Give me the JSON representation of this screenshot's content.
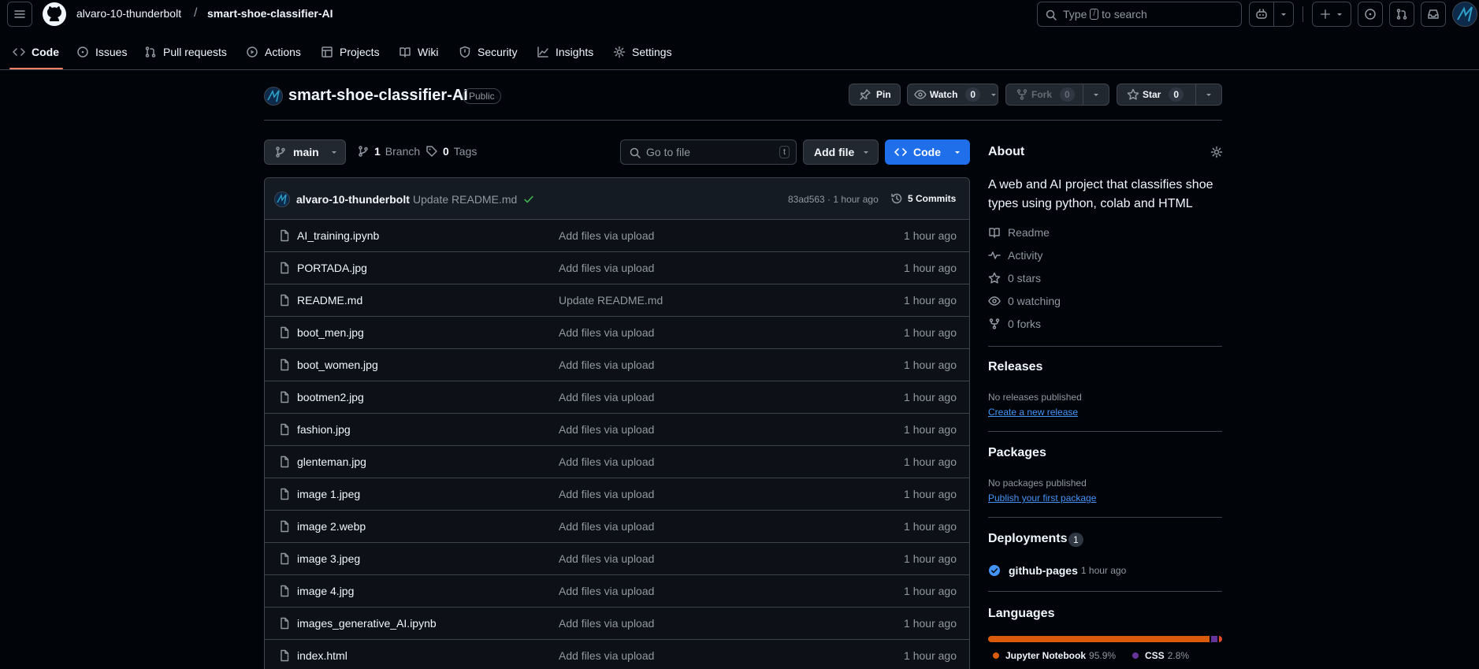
{
  "header": {
    "owner": "alvaro-10-thunderbolt",
    "separator": "/",
    "repo": "smart-shoe-classifier-AI",
    "search_before": "Type",
    "search_key": "/",
    "search_after": "to search"
  },
  "nav": {
    "tabs": [
      {
        "label": "Code",
        "icon": "code-icon"
      },
      {
        "label": "Issues",
        "icon": "issue-icon"
      },
      {
        "label": "Pull requests",
        "icon": "pull-request-icon"
      },
      {
        "label": "Actions",
        "icon": "play-icon"
      },
      {
        "label": "Projects",
        "icon": "table-icon"
      },
      {
        "label": "Wiki",
        "icon": "book-icon"
      },
      {
        "label": "Security",
        "icon": "shield-icon"
      },
      {
        "label": "Insights",
        "icon": "graph-icon"
      },
      {
        "label": "Settings",
        "icon": "gear-icon"
      }
    ]
  },
  "repo": {
    "name": "smart-shoe-classifier-AI",
    "visibility": "Public",
    "pin_label": "Pin",
    "watch_label": "Watch",
    "watch_count": "0",
    "fork_label": "Fork",
    "fork_count": "0",
    "star_label": "Star",
    "star_count": "0"
  },
  "toolbar": {
    "branch": "main",
    "branch_count": "1",
    "branch_label": "Branch",
    "tag_count": "0",
    "tag_label": "Tags",
    "goto_placeholder": "Go to file",
    "goto_key": "t",
    "add_file_label": "Add file",
    "code_label": "Code"
  },
  "latest_commit": {
    "author": "alvaro-10-thunderbolt",
    "message": "Update README.md",
    "hash_time": "83ad563 · 1 hour ago",
    "commits_label": "5 Commits"
  },
  "files": [
    {
      "name": "AI_training.ipynb",
      "message": "Add files via upload",
      "time": "1 hour ago"
    },
    {
      "name": "PORTADA.jpg",
      "message": "Add files via upload",
      "time": "1 hour ago"
    },
    {
      "name": "README.md",
      "message": "Update README.md",
      "time": "1 hour ago"
    },
    {
      "name": "boot_men.jpg",
      "message": "Add files via upload",
      "time": "1 hour ago"
    },
    {
      "name": "boot_women.jpg",
      "message": "Add files via upload",
      "time": "1 hour ago"
    },
    {
      "name": "bootmen2.jpg",
      "message": "Add files via upload",
      "time": "1 hour ago"
    },
    {
      "name": "fashion.jpg",
      "message": "Add files via upload",
      "time": "1 hour ago"
    },
    {
      "name": "glenteman.jpg",
      "message": "Add files via upload",
      "time": "1 hour ago"
    },
    {
      "name": "image 1.jpeg",
      "message": "Add files via upload",
      "time": "1 hour ago"
    },
    {
      "name": "image 2.webp",
      "message": "Add files via upload",
      "time": "1 hour ago"
    },
    {
      "name": "image 3.jpeg",
      "message": "Add files via upload",
      "time": "1 hour ago"
    },
    {
      "name": "image 4.jpg",
      "message": "Add files via upload",
      "time": "1 hour ago"
    },
    {
      "name": "images_generative_AI.ipynb",
      "message": "Add files via upload",
      "time": "1 hour ago"
    },
    {
      "name": "index.html",
      "message": "Add files via upload",
      "time": "1 hour ago"
    }
  ],
  "about": {
    "heading": "About",
    "description": "A web and AI project that classifies shoe types using python, colab and HTML",
    "readme": "Readme",
    "activity": "Activity",
    "stars": "0 stars",
    "watching": "0 watching",
    "forks": "0 forks"
  },
  "releases": {
    "heading": "Releases",
    "text": "No releases published",
    "link": "Create a new release"
  },
  "packages": {
    "heading": "Packages",
    "text": "No packages published",
    "link": "Publish your first package"
  },
  "deployments": {
    "heading": "Deployments",
    "count": "1",
    "name": "github-pages",
    "time": "1 hour ago"
  },
  "languages": {
    "heading": "Languages",
    "items": [
      {
        "name": "Jupyter Notebook",
        "percent": "95.9%",
        "value": 95.9,
        "color": "#DA5B0B"
      },
      {
        "name": "CSS",
        "percent": "2.8%",
        "value": 2.8,
        "color": "#663399"
      },
      {
        "name": "",
        "percent": "",
        "value": 1.3,
        "color": "#e34c26"
      }
    ]
  },
  "colors": {
    "accent": "#1f6feb",
    "underline": "#f78166",
    "success": "#3fb950"
  }
}
